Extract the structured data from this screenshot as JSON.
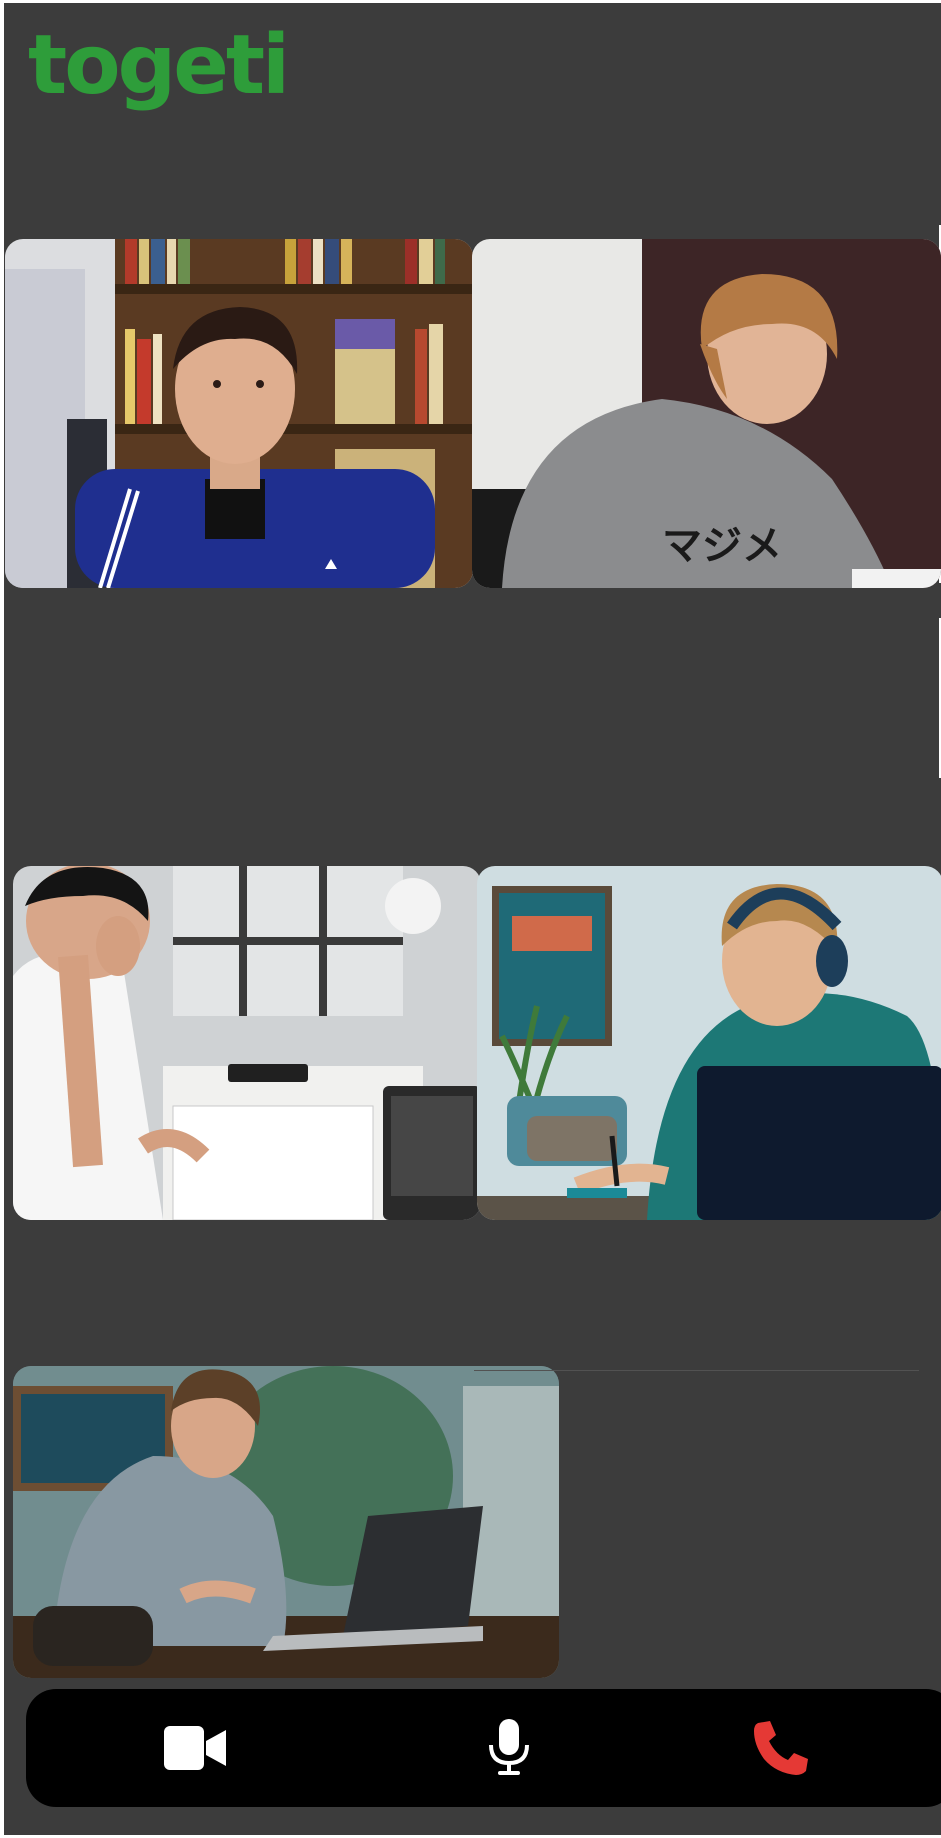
{
  "app": {
    "logo_text": "togeti",
    "brand_color": "#2e9d3a",
    "background_color": "#3c3c3c"
  },
  "participants": [
    {
      "id": 1,
      "video": "participant-video-1"
    },
    {
      "id": 2,
      "video": "participant-video-2"
    },
    {
      "id": 3,
      "video": "participant-video-3"
    },
    {
      "id": 4,
      "video": "participant-video-4"
    },
    {
      "id": 5,
      "video": "participant-video-5"
    }
  ],
  "controls": [
    {
      "name": "camera-toggle",
      "icon": "video-camera-icon",
      "color": "#ffffff"
    },
    {
      "name": "microphone-toggle",
      "icon": "microphone-icon",
      "color": "#ffffff"
    },
    {
      "name": "end-call",
      "icon": "phone-hangup-icon",
      "color": "#e53935"
    }
  ]
}
